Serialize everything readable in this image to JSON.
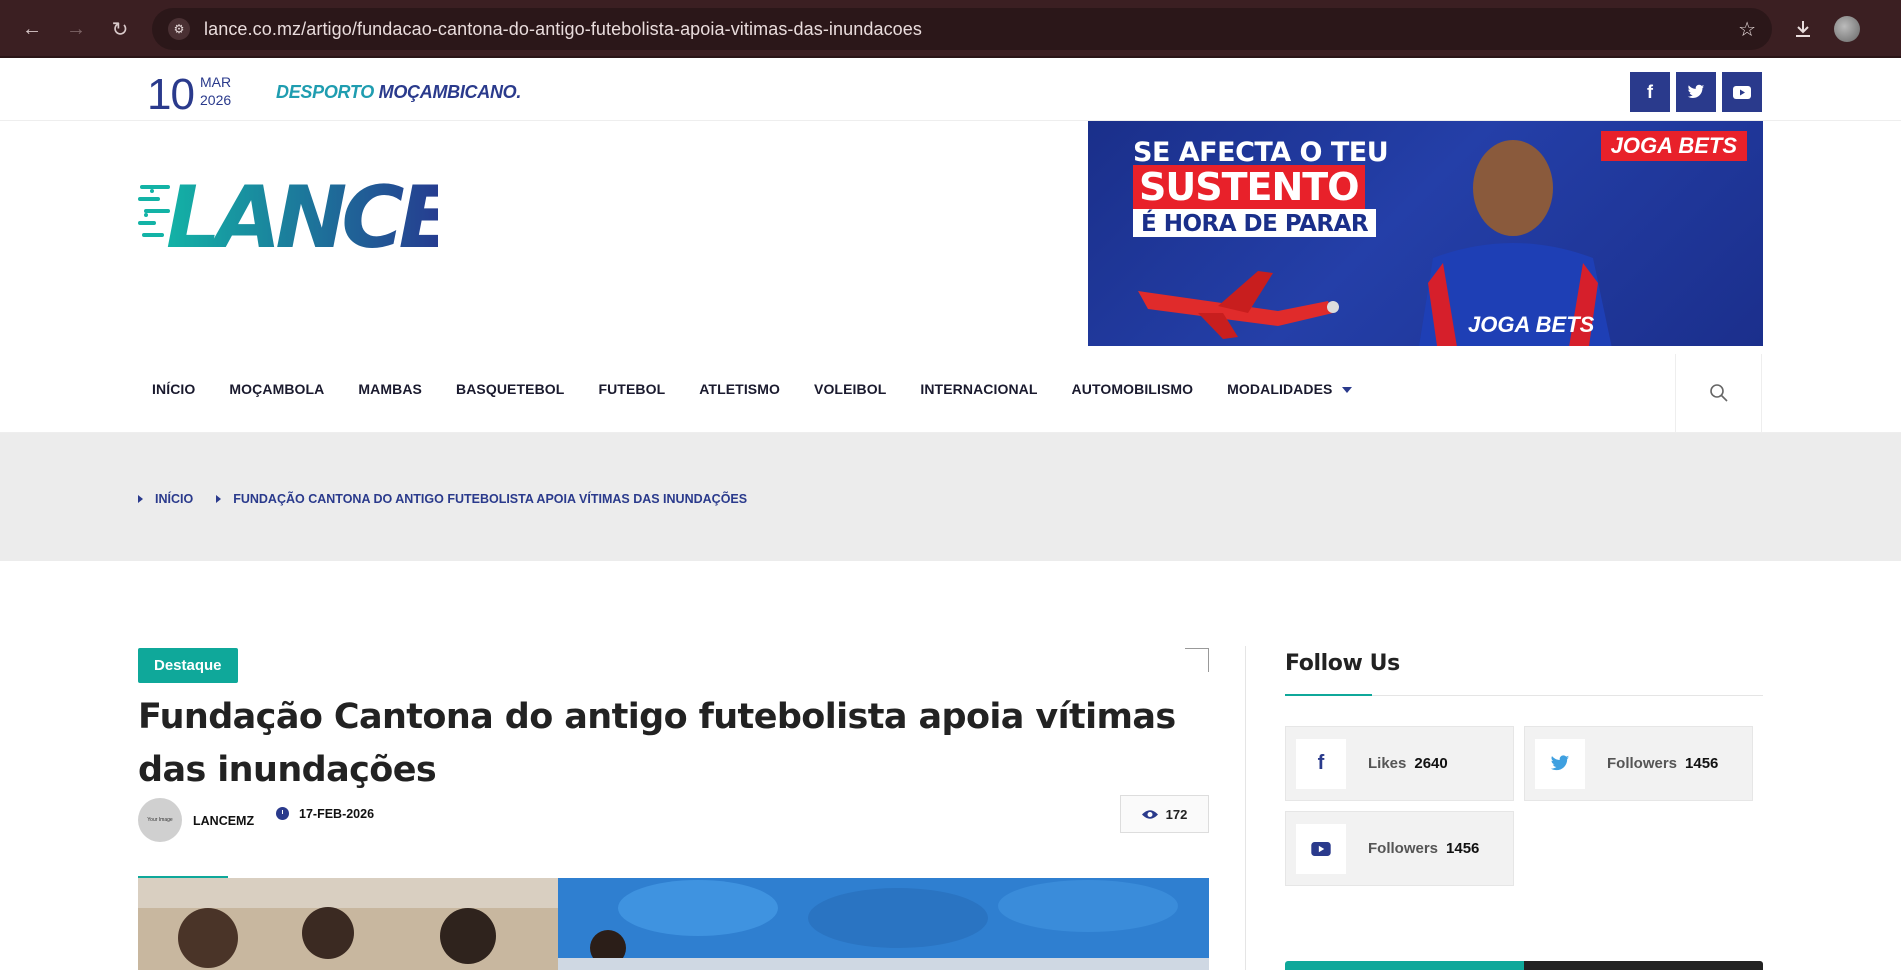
{
  "browser": {
    "url": "lance.co.mz/artigo/fundacao-cantona-do-antigo-futebolista-apoia-vitimas-das-inundacoes"
  },
  "topbar": {
    "day": "10",
    "month": "MAR",
    "year": "2026",
    "tagline_a": "DESPORTO ",
    "tagline_b": "MOÇAMBICANO."
  },
  "logo": {
    "text": "LANCE"
  },
  "banner": {
    "line1": "SE AFECTA O TEU",
    "line2": "SUSTENTO",
    "line3": "É HORA DE PARAR",
    "brand": "JOGA BETS",
    "brand_shirt": "JOGA BETS"
  },
  "nav": {
    "items": [
      "INÍCIO",
      "MOÇAMBOLA",
      "MAMBAS",
      "BASQUETEBOL",
      "FUTEBOL",
      "ATLETISMO",
      "VOLEIBOL",
      "INTERNACIONAL",
      "AUTOMOBILISMO",
      "MODALIDADES"
    ]
  },
  "breadcrumb": {
    "home": "INÍCIO",
    "current": "FUNDAÇÃO CANTONA DO ANTIGO FUTEBOLISTA APOIA VÍTIMAS DAS INUNDAÇÕES"
  },
  "article": {
    "category": "Destaque",
    "title": "Fundação Cantona do antigo futebolista apoia vítimas das inundações",
    "avatar_text": "Your Image",
    "author": "LANCEMZ",
    "date": "17-FEB-2026",
    "views": "172"
  },
  "sidebar": {
    "follow_title": "Follow Us",
    "facebook": {
      "label": "Likes",
      "value": "2640"
    },
    "twitter": {
      "label": "Followers",
      "value": "1456"
    },
    "youtube": {
      "label": "Followers",
      "value": "1456"
    }
  },
  "colors": {
    "brand_blue": "#2a3a8c",
    "accent_teal": "#0fa89a",
    "chrome_bg": "#3b1f22"
  }
}
